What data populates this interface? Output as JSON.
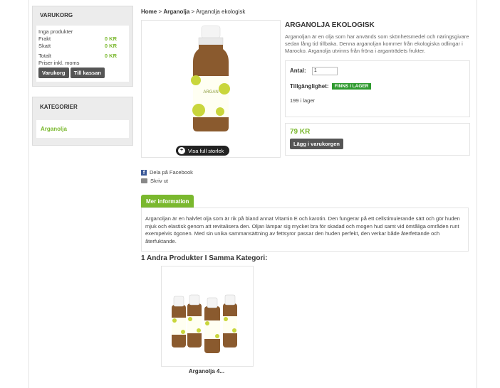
{
  "sidebar": {
    "cart": {
      "title": "VARUKORG",
      "empty_text": "Inga produkter",
      "rows": [
        {
          "label": "Frakt",
          "value": "0 KR"
        },
        {
          "label": "Skatt",
          "value": "0 KR"
        },
        {
          "label": "Totalt",
          "value": "0 KR"
        }
      ],
      "note": "Priser inkl. moms",
      "btn_cart": "Varukorg",
      "btn_checkout": "Till kassan"
    },
    "categories": {
      "title": "KATEGORIER",
      "items": [
        "Arganolja"
      ]
    }
  },
  "breadcrumb": {
    "home": "Home",
    "sep1": ">",
    "cat": "Arganolja",
    "sep2": ">",
    "current": "Arganolja ekologisk"
  },
  "product": {
    "title": "ARGANOLJA EKOLOGISK",
    "short_desc": "Arganoljan är en olja som har används som skönhetsmedel och näringsgivare sedan lång tid tillbaka. Denna arganoljan kommer från ekologiska odlingar i Marocko. Arganolja utvinns från fröna i arganträdets frukter.",
    "qty_label": "Antal:",
    "qty_value": "1",
    "availability_label": "Tillgänglighet:",
    "availability_badge": "FINNS I LAGER",
    "stock_text": "199 i lager",
    "price": "79 KR",
    "add_button": "Lägg i varukorgen",
    "full_size": "Visa full storlek",
    "bottle_label": "ARGAN"
  },
  "share": {
    "facebook": "Dela på Facebook",
    "print": "Skriv ut"
  },
  "tabs": {
    "more_info": "Mer information",
    "content": "Arganoljan är en halvfet olja som är rik på bland annat Vitamin E och karotin. Den fungerar på ett cellstimulerande sätt och gör huden mjuk och elastisk genom att revitalisera den. Oljan lämpar sig mycket bra för skadad och mogen hud samt vid ömtåliga områden runt exempelvis ögonen. Med sin unika sammansättning av fettsyror passar den huden perfekt, den verkar både återfettande och återfuktande."
  },
  "related": {
    "title": "1 Andra Produkter I Samma Kategori:",
    "items": [
      {
        "name": "Arganolja 4..."
      }
    ]
  },
  "colors": {
    "accent_green": "#7ab82e",
    "stock_green": "#2e9a2e",
    "dark_button": "#555555"
  }
}
